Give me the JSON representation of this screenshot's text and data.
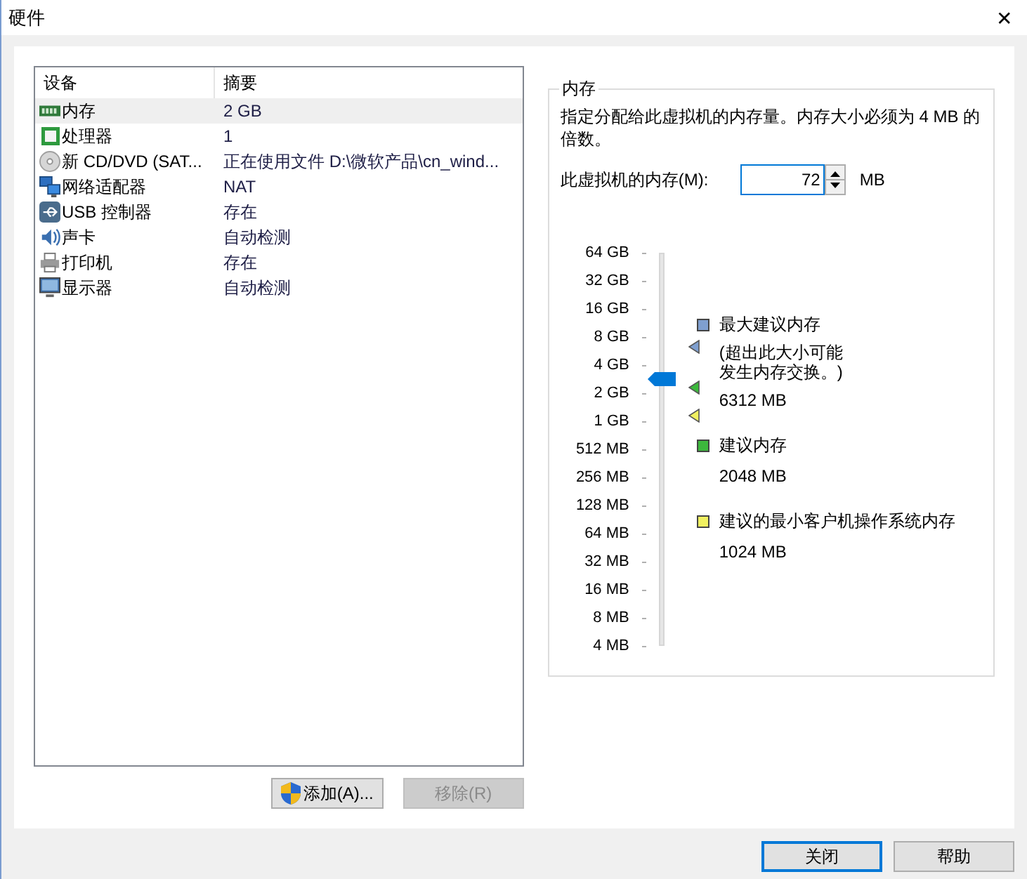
{
  "window": {
    "title": "硬件",
    "close": "✕"
  },
  "devices": {
    "columns": [
      "设备",
      "摘要"
    ],
    "rows": [
      {
        "kind": "memory",
        "device": "内存",
        "summary": "2 GB",
        "selected": true
      },
      {
        "kind": "cpu",
        "device": "处理器",
        "summary": "1",
        "selected": false
      },
      {
        "kind": "disc",
        "device": "新 CD/DVD (SAT...",
        "summary": "正在使用文件 D:\\微软产品\\cn_wind...",
        "selected": false
      },
      {
        "kind": "network",
        "device": "网络适配器",
        "summary": "NAT",
        "selected": false
      },
      {
        "kind": "usb",
        "device": "USB 控制器",
        "summary": "存在",
        "selected": false
      },
      {
        "kind": "sound",
        "device": "声卡",
        "summary": "自动检测",
        "selected": false
      },
      {
        "kind": "printer",
        "device": "打印机",
        "summary": "存在",
        "selected": false
      },
      {
        "kind": "display",
        "device": "显示器",
        "summary": "自动检测",
        "selected": false
      }
    ]
  },
  "list_buttons": [
    {
      "label": "添加(A)...",
      "disabled": false,
      "shield": true
    },
    {
      "label": "移除(R)",
      "disabled": true,
      "shield": false
    }
  ],
  "memory": {
    "title": "内存",
    "description": "指定分配给此虚拟机的内存量。内存大小必须为 4 MB 的倍数。",
    "field_label": "此虚拟机的内存(M):",
    "value": "72",
    "unit": "MB",
    "slider": {
      "labels": [
        "64 GB",
        "32 GB",
        "16 GB",
        "8 GB",
        "4 GB",
        "2 GB",
        "1 GB",
        "512 MB",
        "256 MB",
        "128 MB",
        "64 MB",
        "32 MB",
        "16 MB",
        "8 MB",
        "4 MB"
      ],
      "level": 0.68,
      "markers": [
        {
          "level": 0.764,
          "color": "#7f9fcf"
        },
        {
          "level": 0.661,
          "color": "#3cb83c"
        },
        {
          "level": 0.589,
          "color": "#f0f060"
        }
      ]
    },
    "legend": [
      {
        "title": "最大建议内存",
        "note": "(超出此大小可能发生内存交换。)",
        "value": "6312 MB",
        "color": "#7f9fcf"
      },
      {
        "title": "建议内存",
        "value": "2048 MB",
        "color": "#3cb83c"
      },
      {
        "title": "建议的最小客户机操作系统内存",
        "value": "1024 MB",
        "color": "#f0f060"
      }
    ]
  },
  "buttons": [
    {
      "label": "关闭",
      "default": true
    },
    {
      "label": "帮助",
      "default": false
    }
  ]
}
